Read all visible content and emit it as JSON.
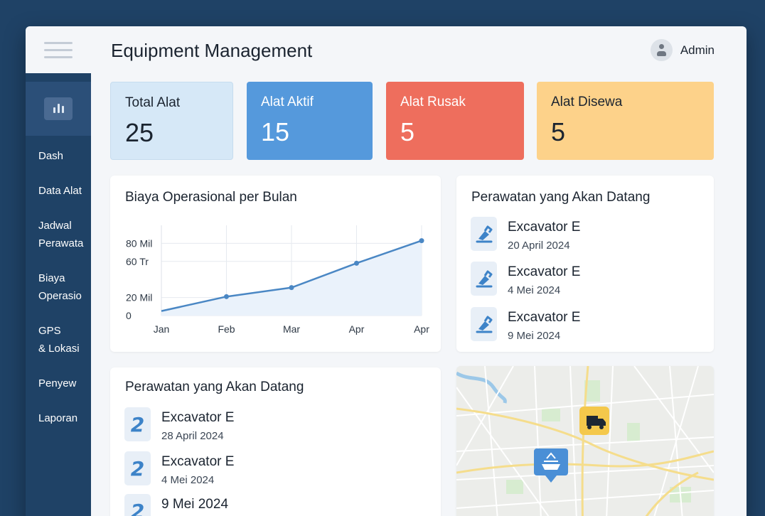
{
  "header": {
    "title": "Equipment Management",
    "user_name": "Admin"
  },
  "sidebar": {
    "items": [
      {
        "label": "Dash"
      },
      {
        "label": "Data Alat"
      },
      {
        "label": "Jadwal\nPerawata"
      },
      {
        "label": "Biaya\nOperasio"
      },
      {
        "label": "GPS\n& Lokasi"
      },
      {
        "label": "Penyew"
      },
      {
        "label": "Laporan"
      }
    ]
  },
  "stats": [
    {
      "label": "Total Alat",
      "value": "25",
      "color": "#d6e8f7"
    },
    {
      "label": "Alat Aktif",
      "value": "15",
      "color": "#5599dc"
    },
    {
      "label": "Alat Rusak",
      "value": "5",
      "color": "#ee6e5d"
    },
    {
      "label": "Alat Disewa",
      "value": "5",
      "color": "#fdd28a"
    }
  ],
  "cost_chart": {
    "title": "Biaya Operasional per Bulan"
  },
  "chart_data": {
    "type": "area",
    "title": "Biaya Operasional per Bulan",
    "categories": [
      "Jan",
      "Feb",
      "Mar",
      "Apr",
      "Apr"
    ],
    "y_tick_labels": [
      "0",
      "20 Mil",
      "60 Tr",
      "80 Mil"
    ],
    "y_tick_values": [
      0,
      20,
      60,
      80
    ],
    "values": [
      5,
      21,
      31,
      58,
      83
    ],
    "ylim": [
      0,
      100
    ],
    "grid": true,
    "line_color": "#4a87c4"
  },
  "maintenance_top": {
    "title": "Perawatan yang Akan Datang",
    "items": [
      {
        "name": "Excavator E",
        "date": "20 April 2024",
        "icon": "excavator-icon"
      },
      {
        "name": "Excavator E",
        "date": "4 Mei 2024",
        "icon": "excavator-icon"
      },
      {
        "name": "Excavator E",
        "date": "9 Mei 2024",
        "icon": "excavator-icon"
      }
    ]
  },
  "maintenance_bottom": {
    "title": "Perawatan yang Akan Datang",
    "items": [
      {
        "name": "Excavator E",
        "date": "28 April 2024",
        "icon": "wrench-icon"
      },
      {
        "name": "Excavator E",
        "date": "4 Mei 2024",
        "icon": "wrench-icon"
      },
      {
        "name": "9 Mei 2024",
        "date": "",
        "icon": "wrench-icon"
      }
    ]
  },
  "map": {
    "markers": [
      {
        "icon": "truck-icon",
        "color": "#f4c84b"
      },
      {
        "icon": "equipment-pin-icon",
        "color": "#4a8fd6"
      }
    ]
  }
}
